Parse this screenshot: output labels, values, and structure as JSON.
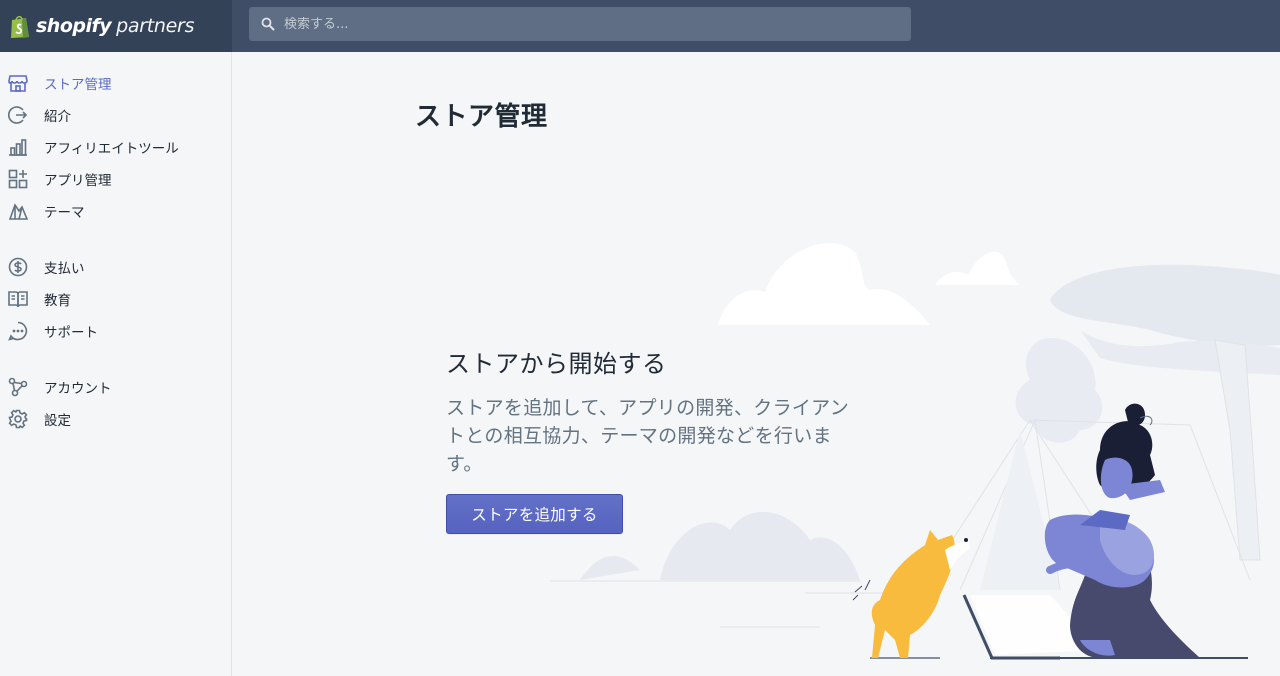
{
  "brand": {
    "name": "shopify",
    "suffix": "partners"
  },
  "search": {
    "placeholder": "検索する..."
  },
  "sidebar": {
    "items": [
      {
        "label": "ストア管理",
        "icon": "store-icon",
        "active": true
      },
      {
        "label": "紹介",
        "icon": "referral-icon"
      },
      {
        "label": "アフィリエイトツール",
        "icon": "chart-bar-icon"
      },
      {
        "label": "アプリ管理",
        "icon": "apps-icon"
      },
      {
        "label": "テーマ",
        "icon": "theme-icon"
      },
      {
        "label": "支払い",
        "icon": "dollar-icon"
      },
      {
        "label": "教育",
        "icon": "book-icon"
      },
      {
        "label": "サポート",
        "icon": "chat-icon"
      },
      {
        "label": "アカウント",
        "icon": "account-icon"
      },
      {
        "label": "設定",
        "icon": "gear-icon"
      }
    ]
  },
  "main": {
    "title": "ストア管理",
    "empty_state": {
      "heading": "ストアから開始する",
      "description": "ストアを追加して、アプリの開発、クライアントとの相互協力、テーマの開発などを行います。",
      "button_label": "ストアを追加する"
    }
  },
  "colors": {
    "topbar": "#3f4e66",
    "brand_bg": "#344258",
    "accent": "#5c6ac4",
    "background": "#f4f6f8"
  }
}
